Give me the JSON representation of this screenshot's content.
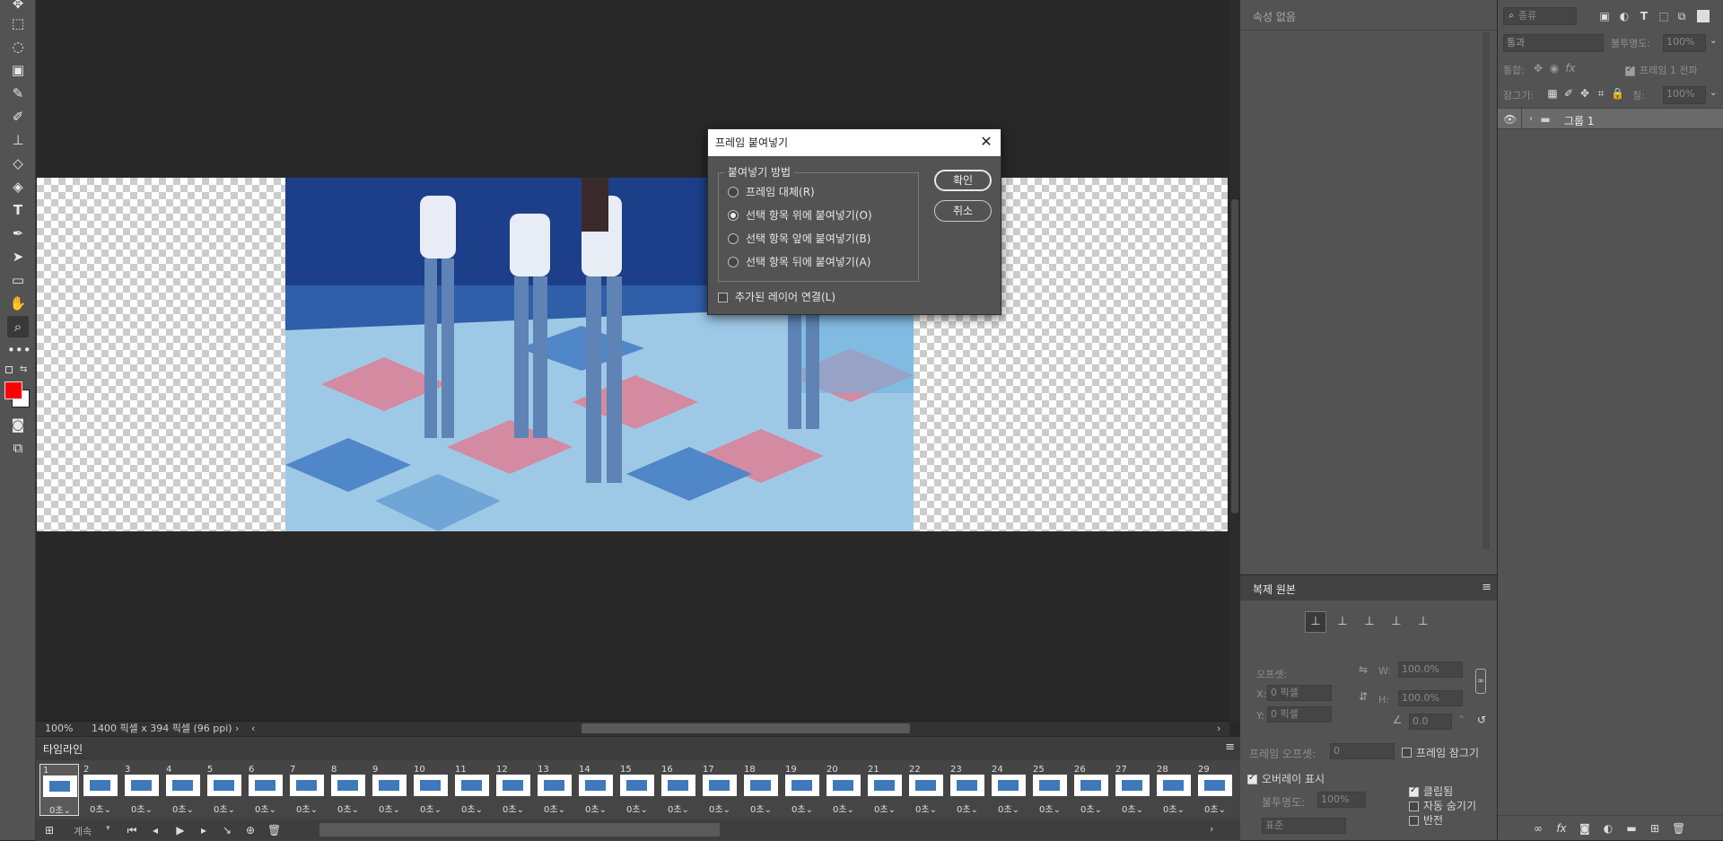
{
  "toolbar": {
    "tools": [
      "move-icon",
      "marquee-icon",
      "lasso-icon",
      "object-select-icon",
      "eyedropper-icon",
      "brush-icon",
      "stamp-icon",
      "eraser-icon",
      "paint-bucket-icon",
      "type-icon",
      "pen-icon",
      "path-select-icon",
      "rectangle-icon",
      "hand-icon",
      "zoom-icon",
      "more-icon"
    ],
    "foreground_color": "#ff0000",
    "background_color": "#ffffff"
  },
  "status": {
    "zoom": "100%",
    "doc_info": "1400 픽셀 x 394 픽셀 (96 ppi)"
  },
  "timeline": {
    "title": "타임라인",
    "frames": [
      {
        "num": "1",
        "delay": "0초"
      },
      {
        "num": "2",
        "delay": "0초"
      },
      {
        "num": "3",
        "delay": "0초"
      },
      {
        "num": "4",
        "delay": "0초"
      },
      {
        "num": "5",
        "delay": "0초"
      },
      {
        "num": "6",
        "delay": "0초"
      },
      {
        "num": "7",
        "delay": "0초"
      },
      {
        "num": "8",
        "delay": "0초"
      },
      {
        "num": "9",
        "delay": "0초"
      },
      {
        "num": "10",
        "delay": "0초"
      },
      {
        "num": "11",
        "delay": "0초"
      },
      {
        "num": "12",
        "delay": "0초"
      },
      {
        "num": "13",
        "delay": "0초"
      },
      {
        "num": "14",
        "delay": "0초"
      },
      {
        "num": "15",
        "delay": "0초"
      },
      {
        "num": "16",
        "delay": "0초"
      },
      {
        "num": "17",
        "delay": "0초"
      },
      {
        "num": "18",
        "delay": "0초"
      },
      {
        "num": "19",
        "delay": "0초"
      },
      {
        "num": "20",
        "delay": "0초"
      },
      {
        "num": "21",
        "delay": "0초"
      },
      {
        "num": "22",
        "delay": "0초"
      },
      {
        "num": "23",
        "delay": "0초"
      },
      {
        "num": "24",
        "delay": "0초"
      },
      {
        "num": "25",
        "delay": "0초"
      },
      {
        "num": "26",
        "delay": "0초"
      },
      {
        "num": "27",
        "delay": "0초"
      },
      {
        "num": "28",
        "delay": "0초"
      },
      {
        "num": "29",
        "delay": "0초"
      }
    ],
    "loop": "계속"
  },
  "properties": {
    "empty_label": "속성 없음"
  },
  "clone_source": {
    "title": "복제 원본",
    "offset_label": "오프셋:",
    "x_label": "X:",
    "x_value": "0 픽셀",
    "y_label": "Y:",
    "y_value": "0 픽셀",
    "w_label": "W:",
    "w_value": "100.0%",
    "h_label": "H:",
    "h_value": "100.0%",
    "angle_value": "0.0",
    "angle_unit": "°",
    "frame_offset_label": "프레임 오프셋:",
    "frame_offset_value": "0",
    "lock_frame_label": "프레임 잠그기",
    "show_overlay_label": "오버레이 표시",
    "opacity_label": "불투명도:",
    "opacity_value": "100%",
    "blend_value": "표준",
    "clipped_label": "클립됨",
    "auto_hide_label": "자동 숨기기",
    "invert_label": "반전"
  },
  "layers": {
    "search_placeholder": "종류",
    "blend_mode": "통과",
    "opacity_label": "불투명도:",
    "opacity_value": "100%",
    "unify_label": "통합:",
    "propagate_label": "프레임 1 전파",
    "lock_label": "잠그기:",
    "fill_label": "칠:",
    "fill_value": "100%",
    "items": [
      {
        "name": "그룹 1"
      }
    ]
  },
  "dialog": {
    "title": "프레임 붙여넣기",
    "group_label": "붙여넣기 방법",
    "options": [
      {
        "label": "프레임 대체(R)",
        "selected": false
      },
      {
        "label": "선택 항목 위에 붙여넣기(O)",
        "selected": true
      },
      {
        "label": "선택 항목 앞에 붙여넣기(B)",
        "selected": false
      },
      {
        "label": "선택 항목 뒤에 붙여넣기(A)",
        "selected": false
      }
    ],
    "link_label": "추가된 레이어 연결(L)",
    "ok_label": "확인",
    "cancel_label": "취소"
  }
}
